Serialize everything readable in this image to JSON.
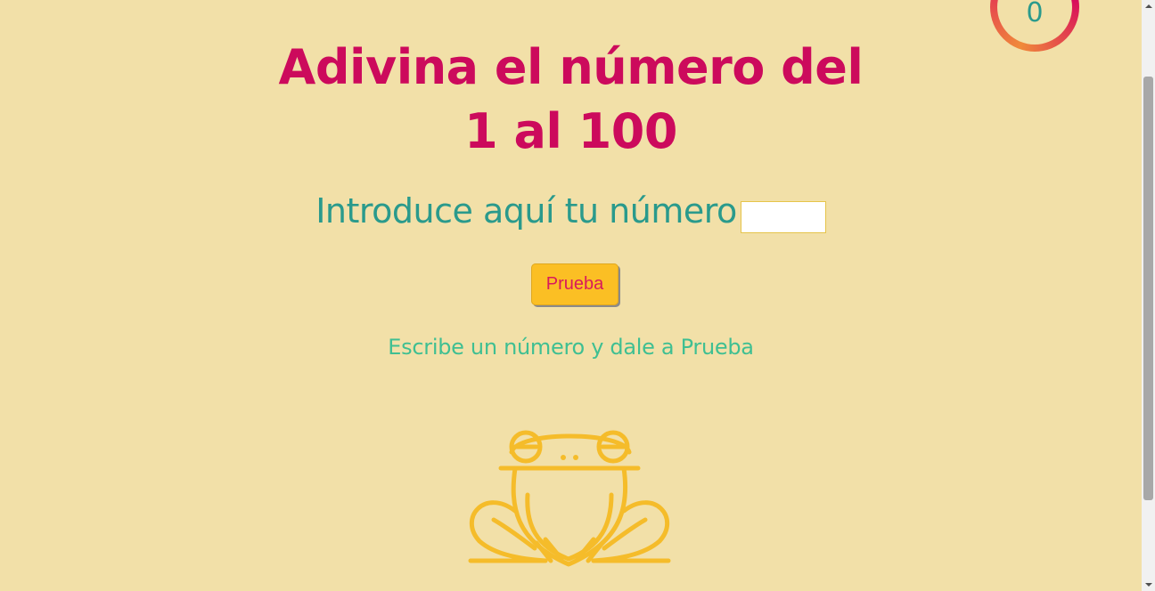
{
  "header": {
    "title_line1": "Adivina el número del",
    "title_line2": "1 al 100"
  },
  "counter": {
    "value": "0"
  },
  "form": {
    "prompt_label": "Introduce aquí tu número",
    "input_value": "",
    "button_label": "Prueba"
  },
  "status": {
    "message": "Escribe un número y dale a Prueba"
  },
  "illustration": {
    "icon": "frog-icon"
  },
  "colors": {
    "background": "#f2e0a8",
    "title": "#cc0a5c",
    "prompt": "#2a9a8c",
    "message": "#3fbf92",
    "button": "#fbbf24",
    "button_text": "#d81a5c",
    "frog": "#f5bc2a"
  }
}
